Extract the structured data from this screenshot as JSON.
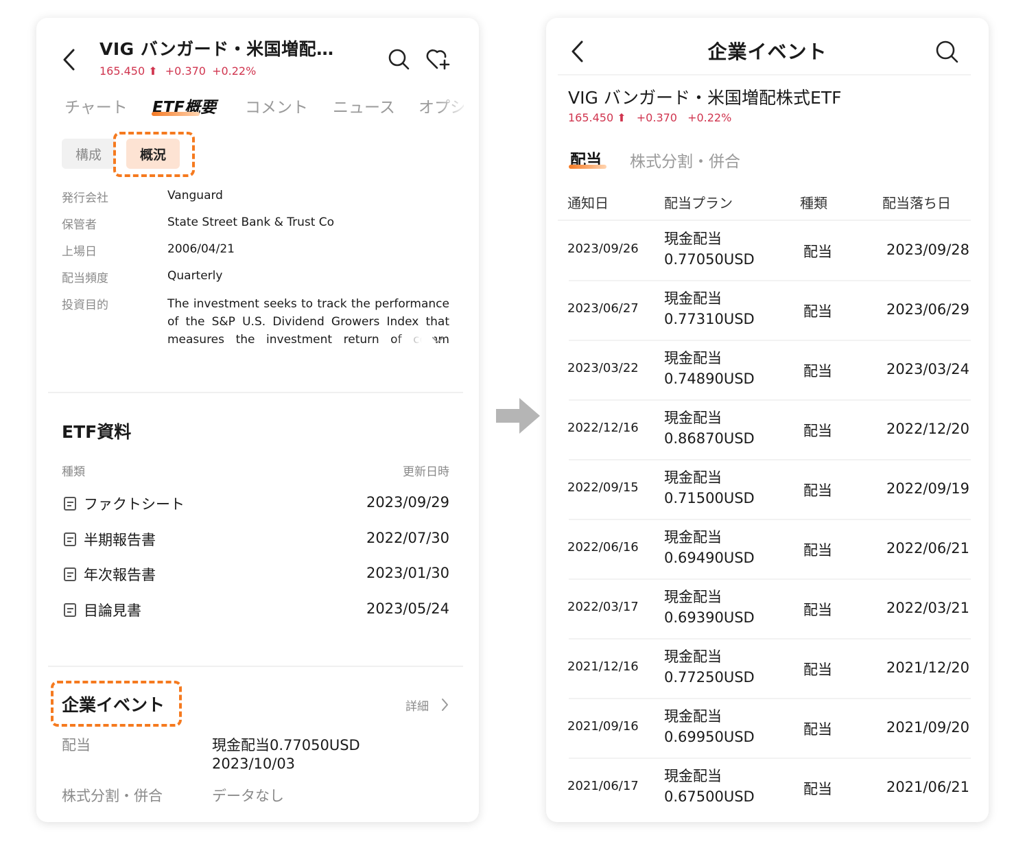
{
  "left": {
    "header": {
      "title": "VIG バンガード・米国増配…",
      "price": "165.450",
      "change": "+0.370",
      "change_pct": "+0.22%"
    },
    "tabs": [
      "チャート",
      "ETF概要",
      "コメント",
      "ニュース",
      "オプシ"
    ],
    "active_tab": "ETF概要",
    "segments": [
      "構成",
      "概況"
    ],
    "active_segment": "概況",
    "info": [
      {
        "label": "発行会社",
        "value": "Vanguard"
      },
      {
        "label": "保管者",
        "value": "State Street Bank & Trust Co"
      },
      {
        "label": "上場日",
        "value": "2006/04/21"
      },
      {
        "label": "配当頻度",
        "value": "Quarterly"
      },
      {
        "label": "投資目的",
        "value": "The investment seeks to track the performance of the S&P U.S. Dividend Growers Index that measures the investment return of comm"
      }
    ],
    "etf_docs": {
      "title": "ETF資料",
      "col_type": "種類",
      "col_updated": "更新日時",
      "items": [
        {
          "name": "ファクトシート",
          "date": "2023/09/29"
        },
        {
          "name": "半期報告書",
          "date": "2022/07/30"
        },
        {
          "name": "年次報告書",
          "date": "2023/01/30"
        },
        {
          "name": "目論見書",
          "date": "2023/05/24"
        }
      ]
    },
    "corporate_events": {
      "title": "企業イベント",
      "detail_link": "詳細",
      "dividend_label": "配当",
      "dividend_value": "現金配当0.77050USD",
      "dividend_date": "2023/10/03",
      "split_label": "株式分割・併合",
      "split_value": "データなし"
    }
  },
  "right": {
    "title": "企業イベント",
    "subtitle": "VIG バンガード・米国増配株式ETF",
    "price": "165.450",
    "change": "+0.370",
    "change_pct": "+0.22%",
    "tabs": [
      "配当",
      "株式分割・併合"
    ],
    "active_tab": "配当",
    "columns": [
      "通知日",
      "配当プラン",
      "種類",
      "配当落ち日"
    ],
    "rows": [
      {
        "notice": "2023/09/26",
        "plan": "現金配当",
        "amount": "0.77050USD",
        "type": "配当",
        "ex_date": "2023/09/28"
      },
      {
        "notice": "2023/06/27",
        "plan": "現金配当",
        "amount": "0.77310USD",
        "type": "配当",
        "ex_date": "2023/06/29"
      },
      {
        "notice": "2023/03/22",
        "plan": "現金配当",
        "amount": "0.74890USD",
        "type": "配当",
        "ex_date": "2023/03/24"
      },
      {
        "notice": "2022/12/16",
        "plan": "現金配当",
        "amount": "0.86870USD",
        "type": "配当",
        "ex_date": "2022/12/20"
      },
      {
        "notice": "2022/09/15",
        "plan": "現金配当",
        "amount": "0.71500USD",
        "type": "配当",
        "ex_date": "2022/09/19"
      },
      {
        "notice": "2022/06/16",
        "plan": "現金配当",
        "amount": "0.69490USD",
        "type": "配当",
        "ex_date": "2022/06/21"
      },
      {
        "notice": "2022/03/17",
        "plan": "現金配当",
        "amount": "0.69390USD",
        "type": "配当",
        "ex_date": "2022/03/21"
      },
      {
        "notice": "2021/12/16",
        "plan": "現金配当",
        "amount": "0.77250USD",
        "type": "配当",
        "ex_date": "2021/12/20"
      },
      {
        "notice": "2021/09/16",
        "plan": "現金配当",
        "amount": "0.69950USD",
        "type": "配当",
        "ex_date": "2021/09/20"
      },
      {
        "notice": "2021/06/17",
        "plan": "現金配当",
        "amount": "0.67500USD",
        "type": "配当",
        "ex_date": "2021/06/21"
      }
    ]
  },
  "colors": {
    "accent_orange": "#f57a1f",
    "price_red": "#d0354f",
    "arrow_gray": "#b5b5b5"
  }
}
